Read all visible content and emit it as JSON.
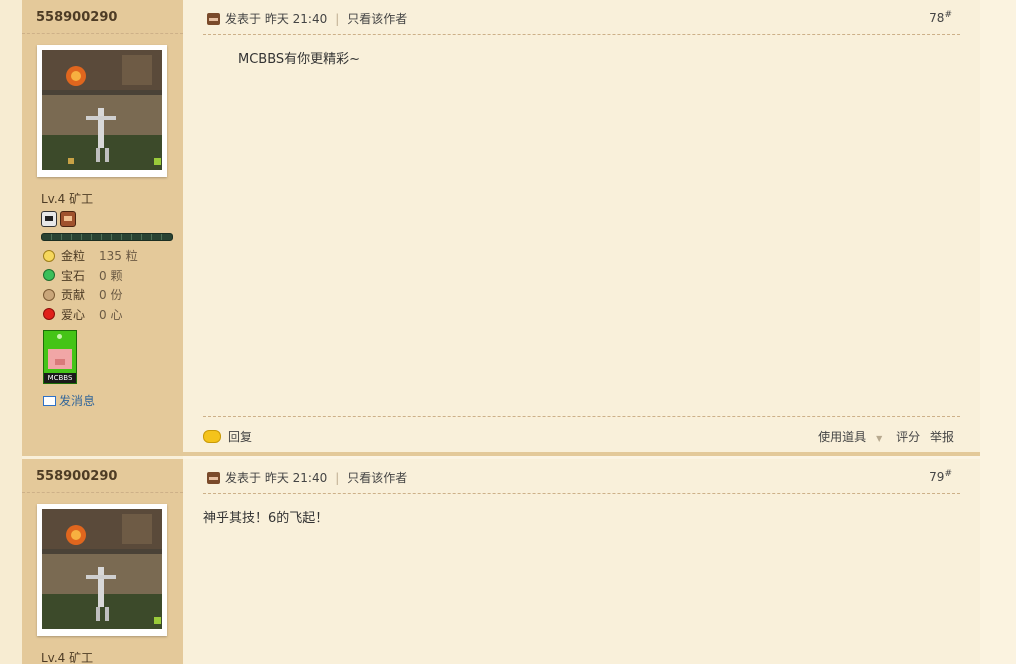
{
  "posts": [
    {
      "username": "558900290",
      "level": "Lv.4 矿工",
      "stats": [
        {
          "icon": "gold-nugget-icon",
          "label": "金粒",
          "value": "135 粒"
        },
        {
          "icon": "gem-icon",
          "label": "宝石",
          "value": "0 颗"
        },
        {
          "icon": "contribution-icon",
          "label": "贡献",
          "value": "0 份"
        },
        {
          "icon": "heart-icon",
          "label": "爱心",
          "value": "0 心"
        }
      ],
      "medal_text": "MCBBS",
      "send_message": "发消息",
      "posted_at": "发表于 昨天 21:40",
      "only_author": "只看该作者",
      "floor_number": "78",
      "floor_suffix": "#",
      "body": "MCBBS有你更精彩~",
      "reply_label": "回复",
      "use_item_label": "使用道具",
      "rate_label": "评分",
      "report_label": "举报"
    },
    {
      "username": "558900290",
      "level": "Lv.4 矿工",
      "posted_at": "发表于 昨天 21:40",
      "only_author": "只看该作者",
      "floor_number": "79",
      "floor_suffix": "#",
      "body": "神乎其技！6的飞起！"
    }
  ],
  "colors": {
    "sidebar_bg": "#e4c99a",
    "content_bg": "#f9f0da",
    "link": "#336699"
  }
}
